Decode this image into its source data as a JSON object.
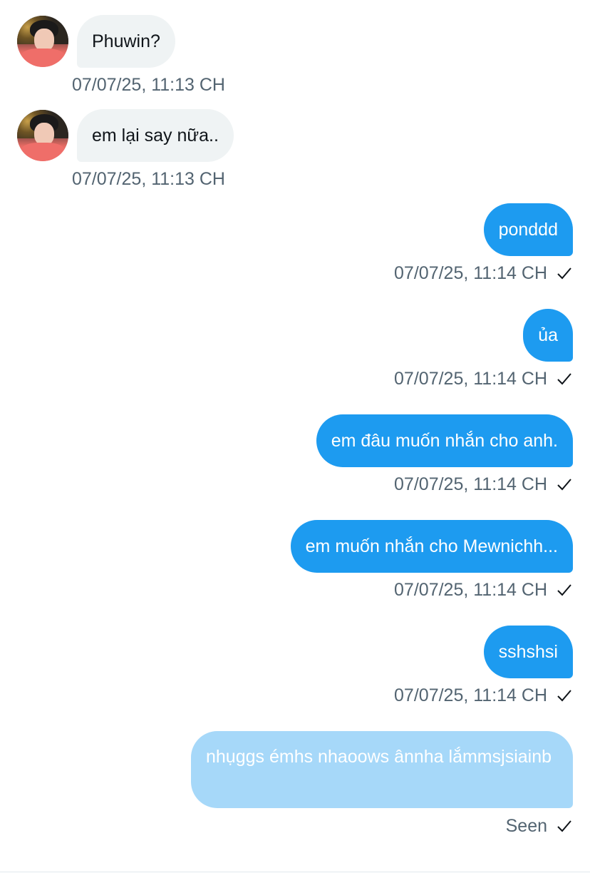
{
  "messages": [
    {
      "direction": "incoming",
      "text": "Phuwin?",
      "timestamp": "07/07/25, 11:13 CH"
    },
    {
      "direction": "incoming",
      "text": "em lại say nữa..",
      "timestamp": "07/07/25, 11:13 CH"
    },
    {
      "direction": "outgoing",
      "text": "ponddd",
      "timestamp": "07/07/25, 11:14 CH"
    },
    {
      "direction": "outgoing",
      "text": "ủa",
      "timestamp": "07/07/25, 11:14 CH"
    },
    {
      "direction": "outgoing",
      "text": "em đâu muốn nhắn cho anh.",
      "timestamp": "07/07/25, 11:14 CH"
    },
    {
      "direction": "outgoing",
      "text": "em muốn nhắn cho Mewnichh...",
      "timestamp": "07/07/25, 11:14 CH"
    },
    {
      "direction": "outgoing",
      "text": "sshshsi",
      "timestamp": "07/07/25, 11:14 CH"
    },
    {
      "direction": "outgoing",
      "text": "nhụggs émhs nhaoows ânnha lắmmsjsiainb",
      "status": "Seen"
    }
  ],
  "icons": {
    "check": "check-icon",
    "avatar": "avatar"
  },
  "colors": {
    "outgoing_bubble": "#1d9bf0",
    "outgoing_pending_bubble": "#a6d8f9",
    "incoming_bubble": "#eff3f4",
    "meta_text": "#536471"
  }
}
